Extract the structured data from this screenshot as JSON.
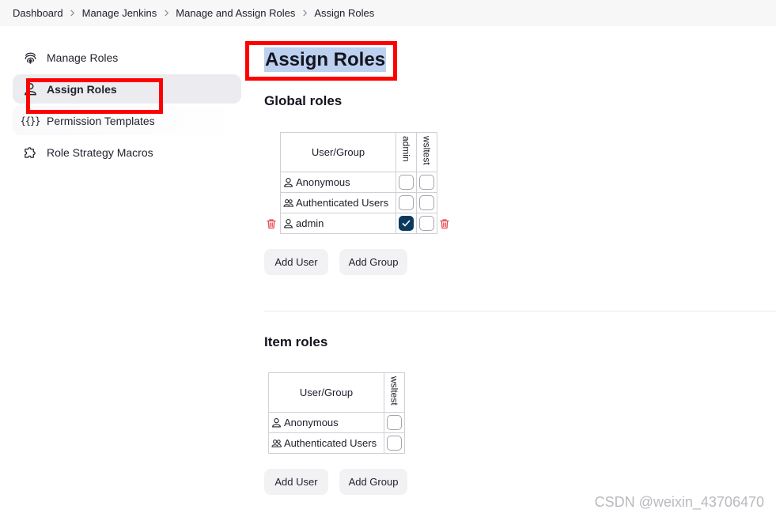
{
  "breadcrumb": [
    "Dashboard",
    "Manage Jenkins",
    "Manage and Assign Roles",
    "Assign Roles"
  ],
  "sidebar": {
    "items": [
      {
        "label": "Manage Roles",
        "icon": "fingerprint-icon"
      },
      {
        "label": "Assign Roles",
        "icon": "user-icon",
        "active": true
      },
      {
        "label": "Permission Templates",
        "icon": "braces-icon",
        "icon_text": "{{}}"
      },
      {
        "label": "Role Strategy Macros",
        "icon": "puzzle-icon"
      }
    ]
  },
  "main": {
    "title": "Assign Roles",
    "global": {
      "heading": "Global roles",
      "header_label": "User/Group",
      "roles": [
        "admin",
        "wsltest"
      ],
      "rows": [
        {
          "name": "Anonymous",
          "icon": "user-icon",
          "checks": [
            false,
            false
          ]
        },
        {
          "name": "Authenticated Users",
          "icon": "group-icon",
          "checks": [
            false,
            false
          ]
        },
        {
          "name": "admin",
          "icon": "user-icon",
          "checks": [
            true,
            false
          ],
          "deletable": true
        }
      ],
      "add_user": "Add User",
      "add_group": "Add Group"
    },
    "item": {
      "heading": "Item roles",
      "header_label": "User/Group",
      "roles": [
        "wsltest"
      ],
      "rows": [
        {
          "name": "Anonymous",
          "icon": "user-icon",
          "checks": [
            false
          ]
        },
        {
          "name": "Authenticated Users",
          "icon": "group-icon",
          "checks": [
            false
          ]
        }
      ],
      "add_user": "Add User",
      "add_group": "Add Group"
    }
  },
  "watermark": "CSDN @weixin_43706470",
  "colors": {
    "annotation": "#ff0000",
    "checked": "#0b3a5d",
    "trash": "#e5484d",
    "title_highlight": "#bcd0ef"
  }
}
